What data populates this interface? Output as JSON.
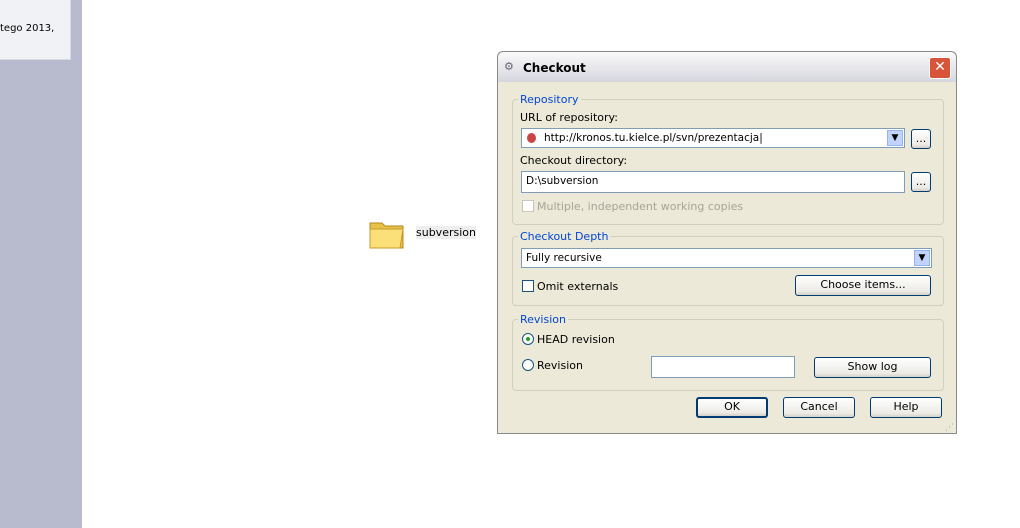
{
  "background": {
    "note_text": "tego 2013,",
    "folder_label": "subversion"
  },
  "dialog": {
    "title": "Checkout",
    "repository": {
      "legend": "Repository",
      "url_label": "URL of repository:",
      "url_value": "http://kronos.tu.kielce.pl/svn/prezentacja",
      "browse": "...",
      "dir_label": "Checkout directory:",
      "dir_value": "D:\\subversion",
      "multiple_label": "Multiple, independent working copies",
      "multiple_checked": false
    },
    "depth": {
      "legend": "Checkout Depth",
      "value": "Fully recursive",
      "omit_label": "Omit externals",
      "omit_checked": false,
      "choose": "Choose items..."
    },
    "revision": {
      "legend": "Revision",
      "head_label": "HEAD revision",
      "rev_label": "Revision",
      "rev_value": "",
      "selected": "HEAD revision",
      "show_log": "Show log"
    },
    "buttons": {
      "ok": "OK",
      "cancel": "Cancel",
      "help": "Help"
    }
  }
}
